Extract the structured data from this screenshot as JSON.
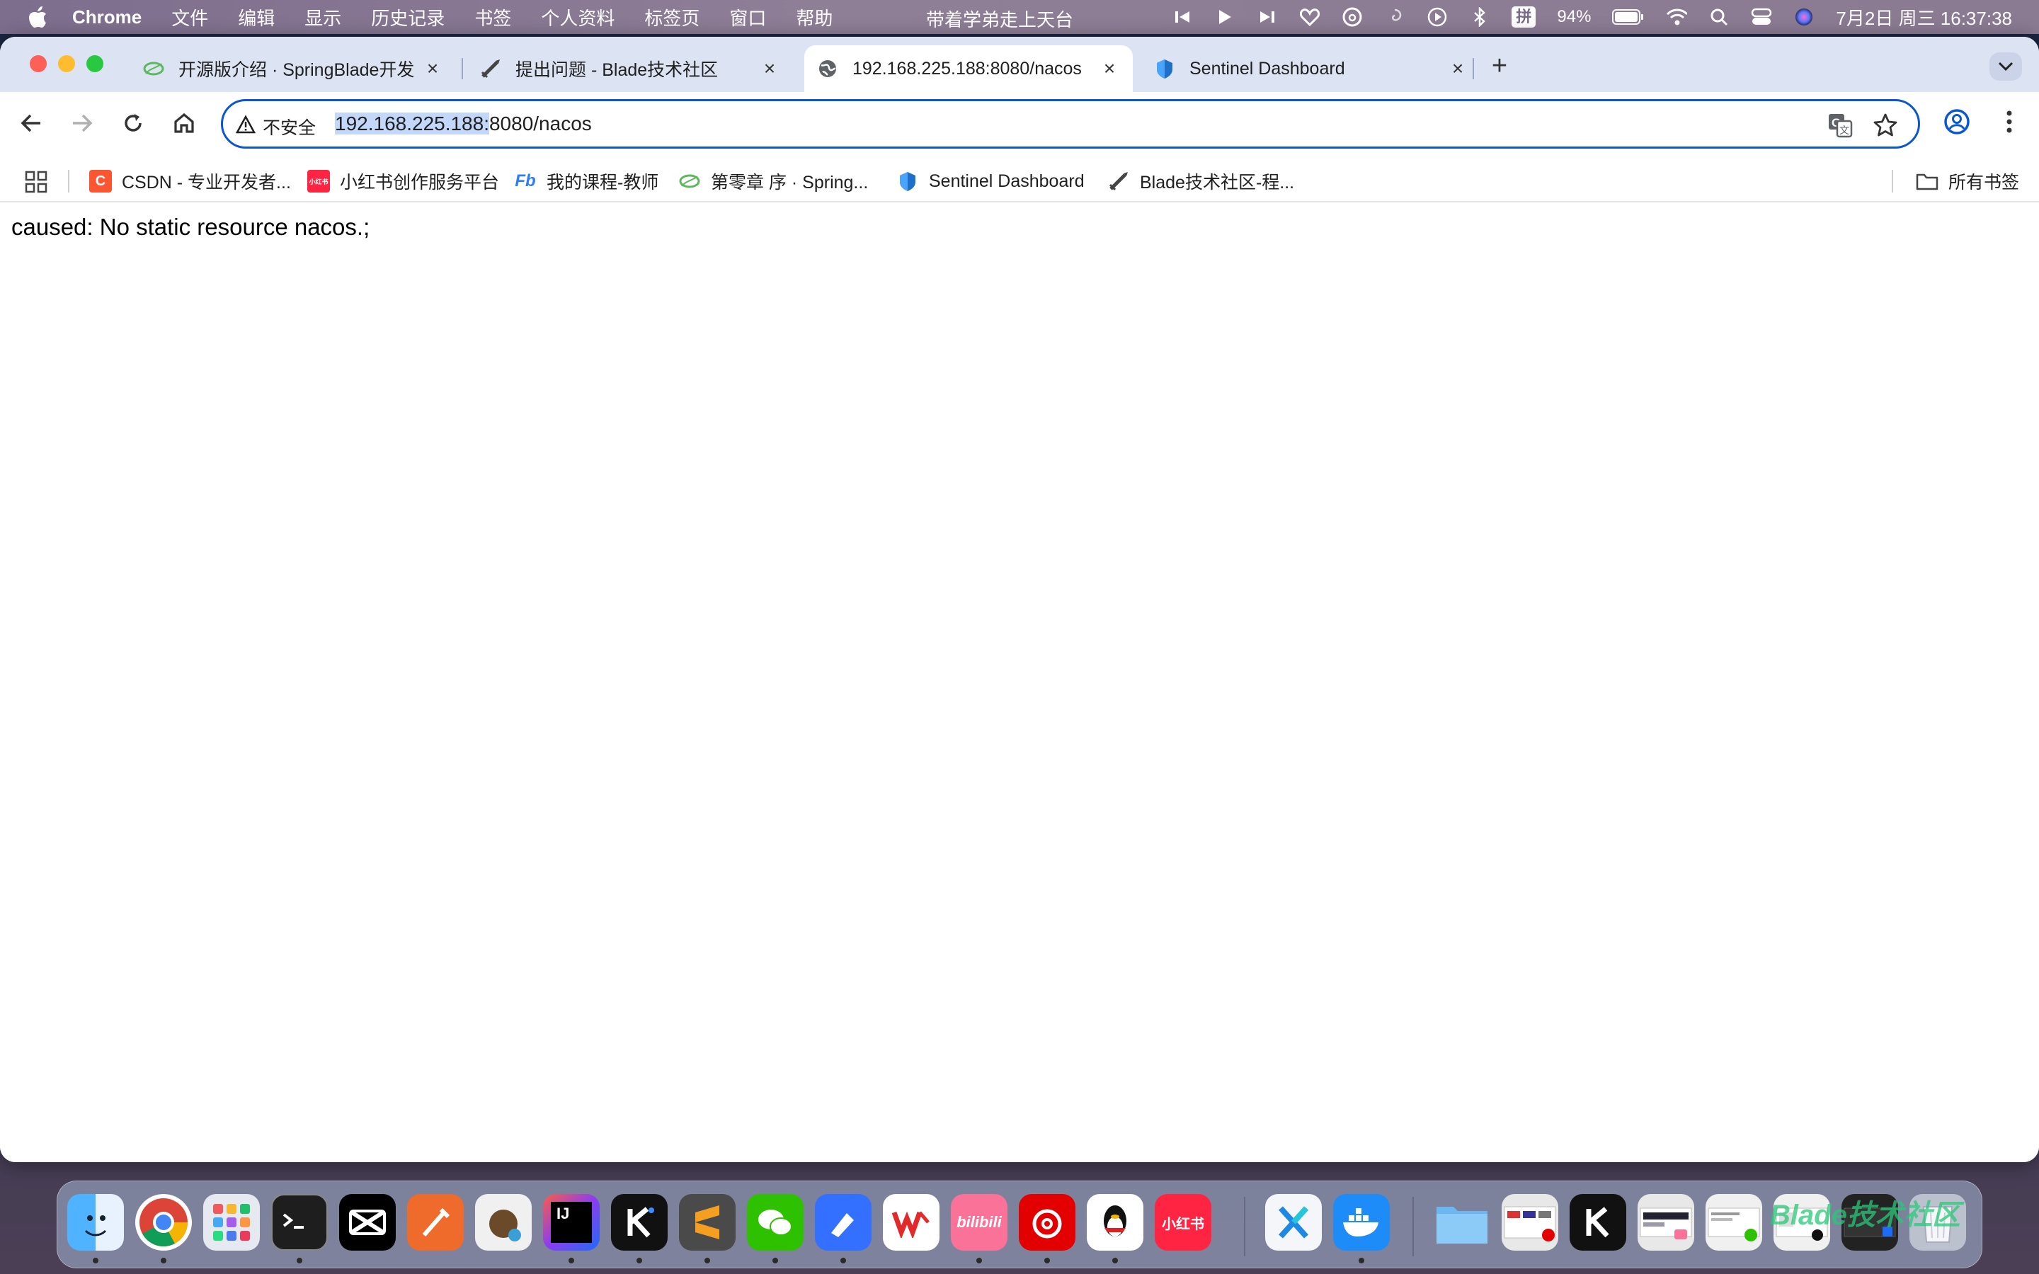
{
  "menubar": {
    "app_name": "Chrome",
    "items": [
      "文件",
      "编辑",
      "显示",
      "历史记录",
      "书签",
      "个人资料",
      "标签页",
      "窗口",
      "帮助"
    ],
    "now_playing": "带着学弟走上天台",
    "battery": "94%",
    "ime": "拼",
    "clock": "7月2日 周三  16:37:38"
  },
  "tabs": [
    {
      "title": "开源版介绍 · SpringBlade开发",
      "icon": "springblade-leaf-icon"
    },
    {
      "title": "提出问题 - Blade技术社区",
      "icon": "blade-sword-icon"
    },
    {
      "title": "192.168.225.188:8080/nacos",
      "icon": "globe-icon",
      "active": true
    },
    {
      "title": "Sentinel Dashboard",
      "icon": "sentinel-shield-icon"
    }
  ],
  "toolbar": {
    "security_label": "不安全",
    "url_selected": "192.168.225.188:",
    "url_rest": "8080/nacos"
  },
  "bookmarks": [
    {
      "label": "CSDN - 专业开发者...",
      "icon": "csdn-icon",
      "badge": "C",
      "color": "#fc5531"
    },
    {
      "label": "小红书创作服务平台",
      "icon": "xiaohongshu-icon",
      "badge": "小红书",
      "color": "#ff2442"
    },
    {
      "label": "我的课程-教师",
      "icon": "fb-course-icon",
      "badge": "Fb",
      "color": "#2f7cf6"
    },
    {
      "label": "第零章 序 · Spring...",
      "icon": "springblade-leaf-icon",
      "badge": "",
      "color": "#5cb85c"
    },
    {
      "label": "Sentinel Dashboard",
      "icon": "sentinel-shield-icon",
      "badge": "",
      "color": "#1f6fc9"
    },
    {
      "label": "Blade技术社区-程...",
      "icon": "blade-sword-icon",
      "badge": "",
      "color": "#444444"
    }
  ],
  "all_bookmarks_label": "所有书签",
  "page": {
    "message": "caused: No static resource nacos.;"
  },
  "dock": {
    "watermark": "Blade技术社区",
    "ide_label": "IJ",
    "xiaohongshu_label": "小红书",
    "bilibili_label": "bilibili",
    "apps": [
      "finder",
      "chrome",
      "launchpad",
      "terminal",
      "capcut",
      "postman",
      "ideaCE",
      "intellij",
      "kimi",
      "sublime",
      "wechat",
      "feishu",
      "wps",
      "bilibili",
      "netease-music",
      "qq",
      "xiaohongshu",
      "xcode-x",
      "docker",
      "downloads"
    ]
  }
}
